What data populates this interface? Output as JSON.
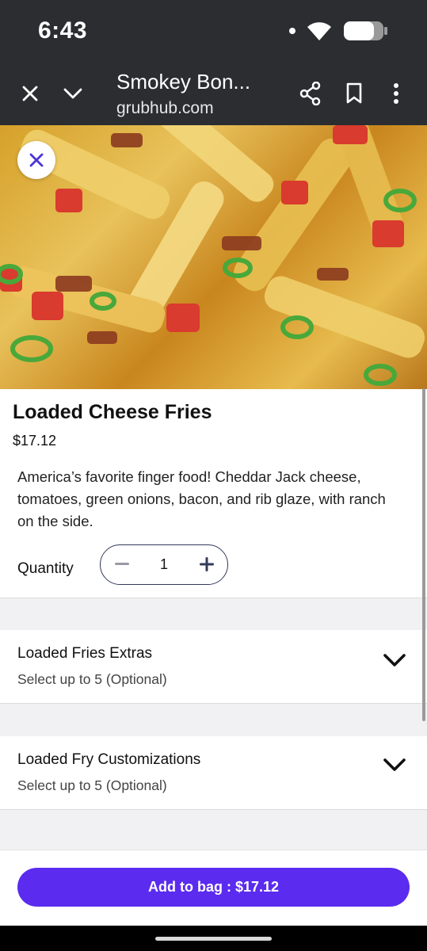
{
  "status_bar": {
    "time": "6:43"
  },
  "browser": {
    "title": "Smokey Bon...",
    "url": "grubhub.com",
    "icons": [
      "close-icon",
      "chevron-down-icon",
      "share-icon",
      "bookmark-icon",
      "more-vert-icon"
    ]
  },
  "item": {
    "name": "Loaded Cheese Fries",
    "price": "$17.12",
    "description": "America’s favorite finger food! Cheddar Jack cheese, tomatoes, green onions, bacon, and rib glaze, with ranch on the side."
  },
  "quantity": {
    "label": "Quantity",
    "value": "1"
  },
  "options": [
    {
      "title": "Loaded Fries Extras",
      "subtitle": "Select up to 5 (Optional)"
    },
    {
      "title": "Loaded Fry Customizations",
      "subtitle": "Select up to 5 (Optional)"
    }
  ],
  "cta": {
    "label": "Add to bag : $17.12"
  },
  "colors": {
    "accent": "#5b2bef",
    "close_icon": "#4a35d9",
    "chrome_bg": "#2b2d31"
  }
}
